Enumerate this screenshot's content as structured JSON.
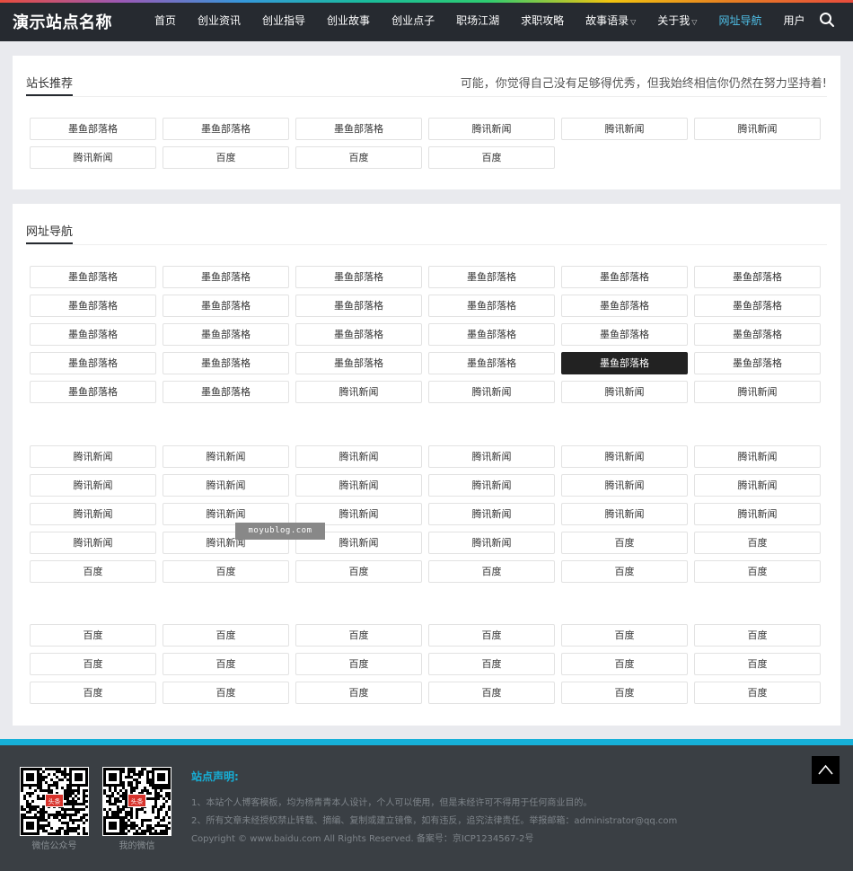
{
  "header": {
    "logo": "演示站点名称",
    "nav": [
      {
        "label": "首页",
        "dropdown": false,
        "active": false
      },
      {
        "label": "创业资讯",
        "dropdown": false,
        "active": false
      },
      {
        "label": "创业指导",
        "dropdown": false,
        "active": false
      },
      {
        "label": "创业故事",
        "dropdown": false,
        "active": false
      },
      {
        "label": "创业点子",
        "dropdown": false,
        "active": false
      },
      {
        "label": "职场江湖",
        "dropdown": false,
        "active": false
      },
      {
        "label": "求职攻略",
        "dropdown": false,
        "active": false
      },
      {
        "label": "故事语录",
        "dropdown": true,
        "active": false
      },
      {
        "label": "关于我",
        "dropdown": true,
        "active": false
      },
      {
        "label": "网址导航",
        "dropdown": false,
        "active": true
      },
      {
        "label": "用户",
        "dropdown": false,
        "active": false
      }
    ],
    "search_icon": "search-icon"
  },
  "recommend": {
    "title": "站长推荐",
    "slogan": "可能，你觉得自己没有足够得优秀，但我始终相信你仍然在努力坚持着!",
    "links": [
      "墨鱼部落格",
      "墨鱼部落格",
      "墨鱼部落格",
      "腾讯新闻",
      "腾讯新闻",
      "腾讯新闻",
      "腾讯新闻",
      "百度",
      "百度",
      "百度"
    ]
  },
  "navigation": {
    "title": "网址导航",
    "groups": [
      {
        "links": [
          "墨鱼部落格",
          "墨鱼部落格",
          "墨鱼部落格",
          "墨鱼部落格",
          "墨鱼部落格",
          "墨鱼部落格",
          "墨鱼部落格",
          "墨鱼部落格",
          "墨鱼部落格",
          "墨鱼部落格",
          "墨鱼部落格",
          "墨鱼部落格",
          "墨鱼部落格",
          "墨鱼部落格",
          "墨鱼部落格",
          "墨鱼部落格",
          "墨鱼部落格",
          "墨鱼部落格",
          "墨鱼部落格",
          "墨鱼部落格",
          "墨鱼部落格",
          "墨鱼部落格",
          "墨鱼部落格",
          "墨鱼部落格",
          "墨鱼部落格",
          "墨鱼部落格",
          "腾讯新闻",
          "腾讯新闻",
          "腾讯新闻",
          "腾讯新闻"
        ],
        "highlight_index": 22
      },
      {
        "links": [
          "腾讯新闻",
          "腾讯新闻",
          "腾讯新闻",
          "腾讯新闻",
          "腾讯新闻",
          "腾讯新闻",
          "腾讯新闻",
          "腾讯新闻",
          "腾讯新闻",
          "腾讯新闻",
          "腾讯新闻",
          "腾讯新闻",
          "腾讯新闻",
          "腾讯新闻",
          "腾讯新闻",
          "腾讯新闻",
          "腾讯新闻",
          "腾讯新闻",
          "腾讯新闻",
          "腾讯新闻",
          "腾讯新闻",
          "腾讯新闻",
          "百度",
          "百度",
          "百度",
          "百度",
          "百度",
          "百度",
          "百度",
          "百度"
        ],
        "highlight_index": -1
      },
      {
        "links": [
          "百度",
          "百度",
          "百度",
          "百度",
          "百度",
          "百度",
          "百度",
          "百度",
          "百度",
          "百度",
          "百度",
          "百度",
          "百度",
          "百度",
          "百度",
          "百度",
          "百度",
          "百度"
        ],
        "highlight_index": -1
      }
    ]
  },
  "watermark": "moyublog.com",
  "footer": {
    "qr_codes": [
      {
        "label": "微信公众号",
        "badge": "头条"
      },
      {
        "label": "我的微信",
        "badge": "头条"
      }
    ],
    "title": "站点声明:",
    "lines": [
      "1、本站个人博客模板，均为杨青青本人设计，个人可以使用，但是未经许可不得用于任何商业目的。",
      "2、所有文章未经授权禁止转载、摘编、复制或建立镜像，如有违反，追究法律责任。举报邮箱：administrator@qq.com",
      "Copyright © www.baidu.com All Rights Reserved. 备案号：京ICP1234567-2号"
    ],
    "back_to_top_icon": "chevron-up-icon"
  },
  "colors": {
    "header_bg": "#262a30",
    "accent": "#16b0d8",
    "active_nav": "#4fc0e8",
    "footer_bg": "#3a3f44"
  }
}
